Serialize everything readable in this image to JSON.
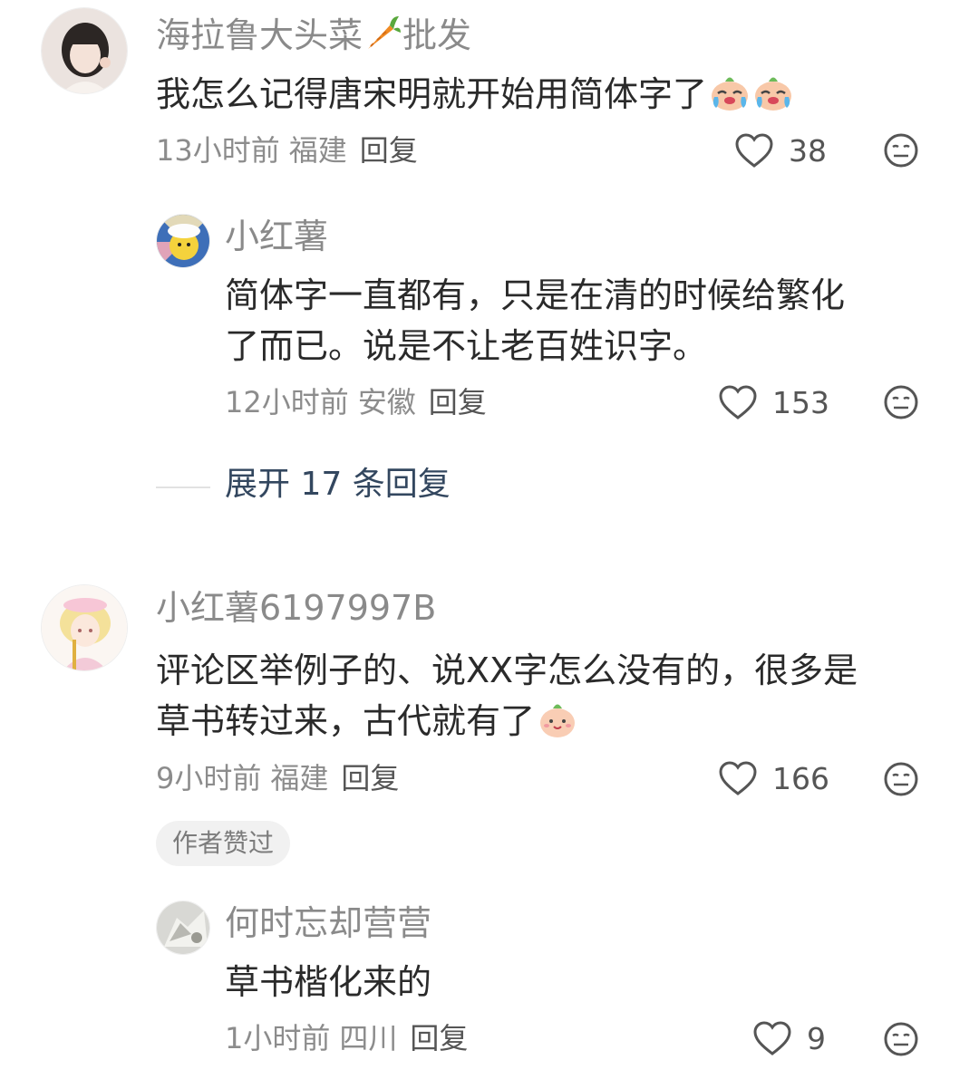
{
  "comments": [
    {
      "username": "海拉鲁大头菜",
      "username_suffix": "批发",
      "text": "我怎么记得唐宋明就开始用简体字了",
      "time": "13小时前",
      "location": "福建",
      "reply_label": "回复",
      "likes": "38"
    },
    {
      "username": "小红薯",
      "text_line1": "简体字一直都有，只是在清的时候给繁化",
      "text_line2": "了而已。说是不让老百姓识字。",
      "time": "12小时前",
      "location": "安徽",
      "reply_label": "回复",
      "likes": "153"
    },
    {
      "username": "小红薯6197997B",
      "text_line1": "评论区举例子的、说XX字怎么没有的，很多是",
      "text_line2": "草书转过来，古代就有了",
      "time": "9小时前",
      "location": "福建",
      "reply_label": "回复",
      "likes": "166",
      "badge": "作者赞过"
    },
    {
      "username": "何时忘却营营",
      "text": "草书楷化来的",
      "time": "1小时前",
      "location": "四川",
      "reply_label": "回复",
      "likes": "9"
    }
  ],
  "expand_replies": "展开 17 条回复",
  "icons": {
    "like": "heart-outline-icon",
    "dislike": "meh-face-icon",
    "username_emoji": "carrot-icon",
    "crying_emoji": "crying-face-emoji",
    "smile_emoji": "smiling-face-emoji"
  },
  "colors": {
    "text": "#2a2a2a",
    "meta": "#8c8c8c",
    "username": "#8a8a8a",
    "expand": "#33475f",
    "badge_bg": "#f1f1f1"
  }
}
